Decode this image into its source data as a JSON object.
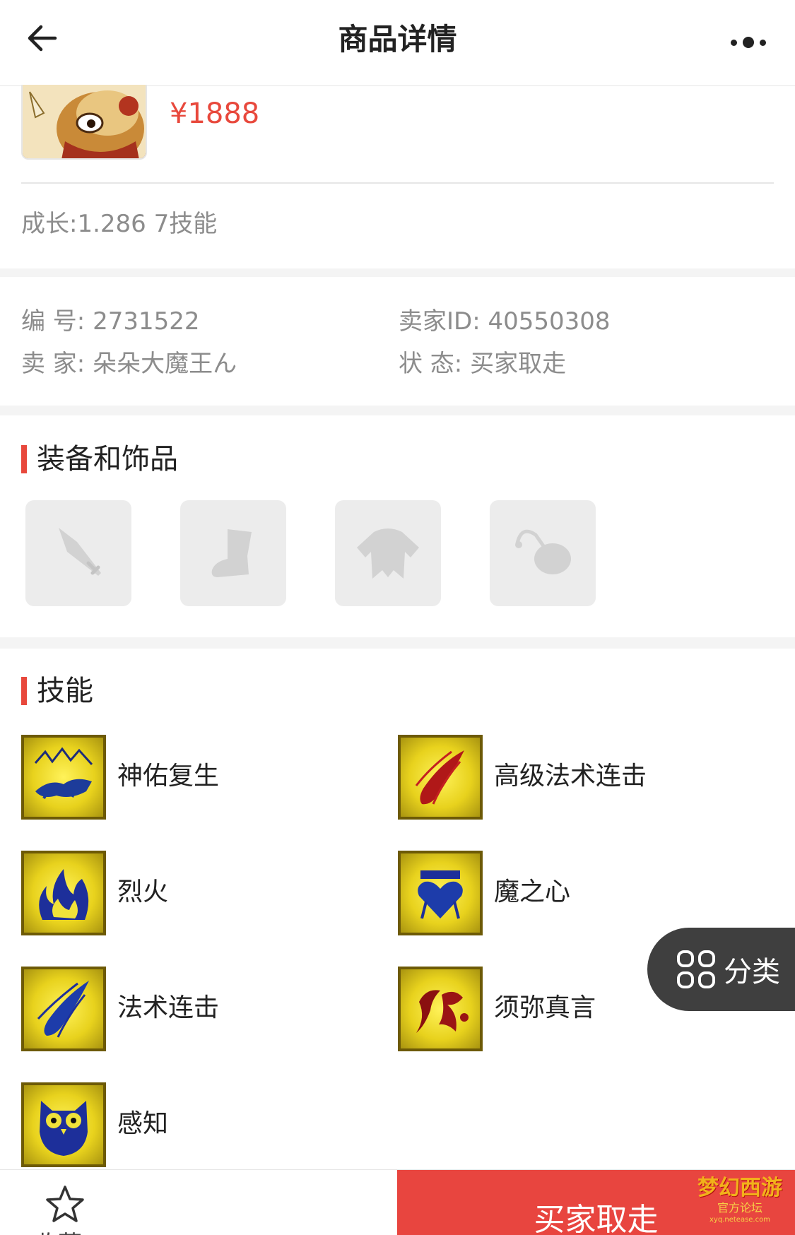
{
  "header": {
    "title": "商品详情"
  },
  "product": {
    "price": "¥1888",
    "growth": "成长:1.286 7技能"
  },
  "info": {
    "number_label": "编 号: 2731522",
    "seller_id_label": "卖家ID: 40550308",
    "seller_label": "卖 家: 朵朵大魔王ん",
    "status_label": "状 态: 买家取走"
  },
  "equipment": {
    "title": "装备和饰品",
    "slots": [
      "weapon-slot",
      "boots-slot",
      "armor-slot",
      "accessory-slot"
    ]
  },
  "skills": {
    "title": "技能",
    "items": [
      {
        "name": "神佑复生",
        "icon": "revive-skill-icon"
      },
      {
        "name": "高级法术连击",
        "icon": "adv-spell-combo-icon"
      },
      {
        "name": "烈火",
        "icon": "fire-skill-icon"
      },
      {
        "name": "魔之心",
        "icon": "magic-heart-icon"
      },
      {
        "name": "法术连击",
        "icon": "spell-combo-icon"
      },
      {
        "name": "须弥真言",
        "icon": "sumeru-mantra-icon"
      },
      {
        "name": "感知",
        "icon": "perception-owl-icon"
      }
    ]
  },
  "float_button": {
    "label": "分类"
  },
  "bottom_bar": {
    "fav_label": "收藏",
    "buy_label": "买家取走"
  },
  "watermark": {
    "top": "梦幻西游",
    "mid": "官方论坛",
    "bot": "xyq.netease.com"
  },
  "colors": {
    "accent": "#e8483c",
    "buy_button": "#e8453f",
    "float_button": "#3f3f3f"
  }
}
